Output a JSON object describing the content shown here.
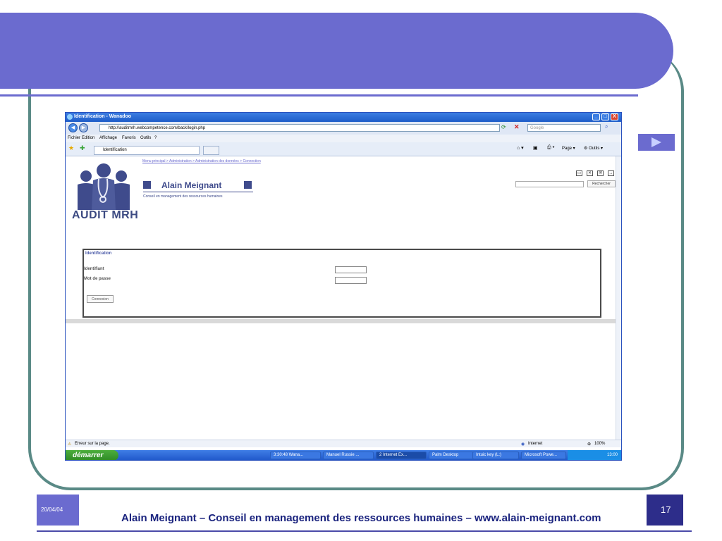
{
  "slide": {
    "date": "20/04/04",
    "number": "17",
    "footer": "Alain Meignant – Conseil en management des ressources humaines – www.alain-meignant.com",
    "colors": {
      "banner": "#6b6bcf",
      "frame": "#5a8a86",
      "footer_text": "#1a237e"
    }
  },
  "browser": {
    "title": "Identification - Wanadoo",
    "window_buttons": [
      "_",
      "□",
      "X"
    ],
    "url": "http://auditmrh.webcompetence.com/back/login.php",
    "search_placeholder": "Google",
    "menu": [
      "Fichier",
      "Edition",
      "Affichage",
      "Favoris",
      "Outils",
      "?"
    ],
    "tab_label": "Identification",
    "toolbar_page": "Page",
    "toolbar_tools": "Outils",
    "status_left": "Erreur sur la page.",
    "status_zone": "Internet",
    "zoom": "100%"
  },
  "page": {
    "breadcrumb": "Menu principal > Administration > Administration des données > Connection",
    "logo_text": "AUDIT MRH",
    "brand_name": "Alain Meignant",
    "brand_sub": "Conseil en management des ressources humaines",
    "search_button": "Rechercher",
    "login": {
      "title": "Identification",
      "id_label": "Identifiant",
      "pw_label": "Mot de passe",
      "submit": "Connexion"
    }
  },
  "taskbar": {
    "start": "démarrer",
    "items": [
      "3:30:48 Wana...",
      "Manuel Russie ...",
      "2 Internet Ex...",
      "Palm Desktop",
      "Intuic key (L:)",
      "Microsoft Powe..."
    ],
    "clock": "13:00"
  }
}
